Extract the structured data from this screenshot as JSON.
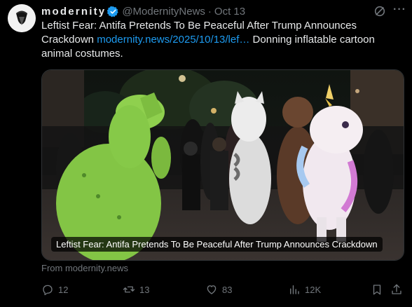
{
  "tweet": {
    "display_name": "modernity",
    "handle": "@ModernityNews",
    "separator": "·",
    "date": "Oct 13",
    "text_before": "Leftist Fear: Antifa Pretends To Be Peaceful After Trump Announces Crackdown ",
    "link_text": "modernity.news/2025/10/13/lef…",
    "text_after": " Donning inflatable cartoon animal costumes."
  },
  "media": {
    "caption": "Leftist Fear: Antifa Pretends To Be Peaceful After Trump Announces Crackdown"
  },
  "source": "From modernity.news",
  "actions": {
    "replies": "12",
    "reposts": "13",
    "likes": "83",
    "views": "12K"
  },
  "colors": {
    "accent": "#1d9bf0",
    "muted": "#71767b",
    "text": "#e7e9ea",
    "background": "#000000"
  }
}
